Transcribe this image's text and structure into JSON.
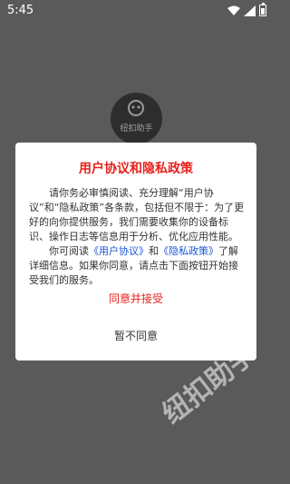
{
  "status_bar": {
    "time": "5:45"
  },
  "splash": {
    "logo_text": "纽扣助手"
  },
  "dialog": {
    "title": "用户协议和隐私政策",
    "paragraph1": "请你务必审慎阅读、充分理解“用户协议”和“隐私政策”各条款，包括但不限于：为了更好的向你提供服务，我们需要收集你的设备标识、操作日志等信息用于分析、优化应用性能。",
    "p2_prefix": "你可阅读",
    "user_agreement_link": "《用户协议》",
    "p2_and": "和",
    "privacy_link": "《隐私政策》",
    "p2_suffix": "了解详细信息。如果你同意，请点击下面按钮开始接受我们的服务。",
    "agree_label": "同意并接受",
    "disagree_label": "暂不同意"
  },
  "watermark": {
    "text": "纽扣助手"
  },
  "colors": {
    "accent": "#e8211e",
    "link": "#1a56d6",
    "overlay": "#5a5a5a"
  }
}
